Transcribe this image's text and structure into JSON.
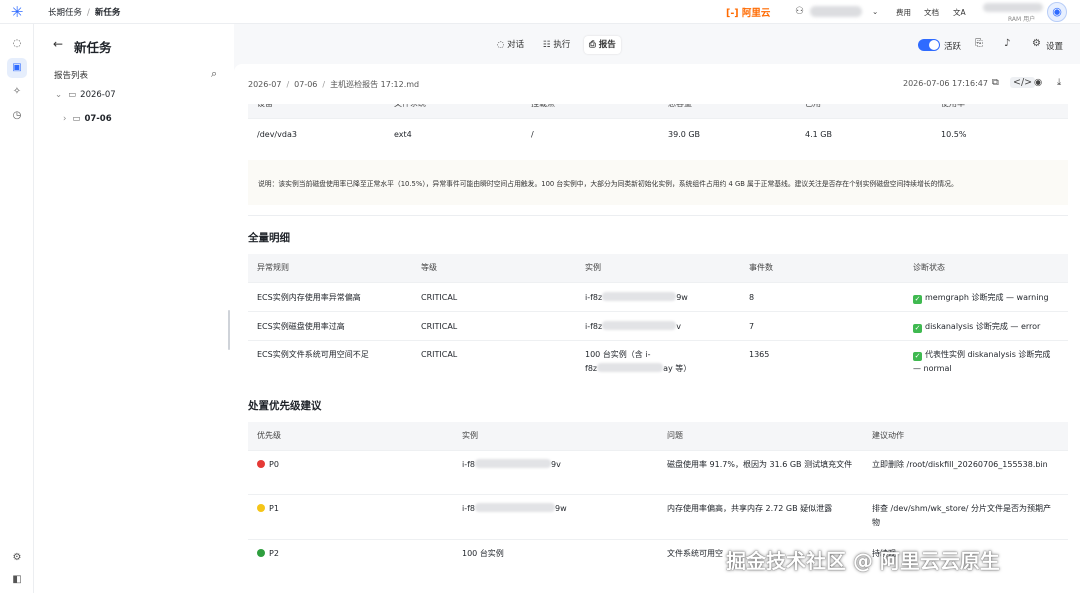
{
  "topbar": {
    "breadcrumb": [
      "长期任务",
      "新任务"
    ],
    "brand": "[-] 阿里云",
    "links": [
      "费用",
      "文档"
    ],
    "user_role": "RAM 用户"
  },
  "sidebar": {
    "title": "新任务",
    "list_label": "报告列表",
    "tree": [
      {
        "label": "2026-07"
      },
      {
        "label": "07-06"
      }
    ]
  },
  "header": {
    "tabs": [
      "对话",
      "执行",
      "报告"
    ],
    "active_tab": "报告",
    "toggle_label": "活跃",
    "settings_label": "设置"
  },
  "file": {
    "path": [
      "2026-07",
      "07-06",
      "主机巡检报告 17:12.md"
    ],
    "time": "2026-07-06 17:16:47"
  },
  "disk_table": {
    "headers": [
      "设备",
      "文件系统",
      "挂载点",
      "总容量",
      "已用",
      "使用率"
    ],
    "row": [
      "/dev/vda3",
      "ext4",
      "/",
      "39.0 GB",
      "4.1 GB",
      "10.5%"
    ]
  },
  "note": "说明：该实例当前磁盘使用率已降至正常水平（10.5%），异常事件可能由瞬时空间占用触发。100 台实例中，大部分为同类新初始化实例，系统组件占用约 4 GB 属于正常基线。建议关注是否存在个别实例磁盘空间持续增长的情况。",
  "detail": {
    "title": "全量明细",
    "headers": [
      "异常规则",
      "等级",
      "实例",
      "事件数",
      "诊断状态"
    ],
    "rows": [
      {
        "rule": "ECS实例内存使用率异常偏高",
        "level": "CRITICAL",
        "inst_a": "i-f8z",
        "inst_b": "9w",
        "count": "8",
        "status": "memgraph 诊断完成 — warning"
      },
      {
        "rule": "ECS实例磁盘使用率过高",
        "level": "CRITICAL",
        "inst_a": "i-f8z",
        "inst_b": "v",
        "count": "7",
        "status": "diskanalysis 诊断完成 — error"
      },
      {
        "rule": "ECS实例文件系统可用空间不足",
        "level": "CRITICAL",
        "inst_a": "100 台实例（含 i-",
        "inst_b": "f8z",
        "inst_c": "ay 等）",
        "count": "1365",
        "status": "代表性实例 diskanalysis 诊断完成 — normal"
      }
    ]
  },
  "priority": {
    "title": "处置优先级建议",
    "headers": [
      "优先级",
      "实例",
      "问题",
      "建议动作"
    ],
    "rows": [
      {
        "level": "P0",
        "color": "#e53935",
        "inst_a": "i-f8",
        "inst_b": "9v",
        "issue": "磁盘使用率 91.7%，根因为 31.6 GB 测试填充文件",
        "action": "立即删除 /root/diskfill_20260706_155538.bin"
      },
      {
        "level": "P1",
        "color": "#f5c518",
        "inst_a": "i-f8",
        "inst_b": "9w",
        "issue": "内存使用率偏高，共享内存 2.72 GB 疑似泄露",
        "action": "排查 /dev/shm/wk_store/ 分片文件是否为预期产物"
      },
      {
        "level": "P2",
        "color": "#2e9e3e",
        "inst_a": "100 台实例",
        "inst_b": "",
        "issue": "文件系统可用空",
        "action": "持续观"
      }
    ]
  },
  "watermark": "掘金技术社区 @ 阿里云云原生"
}
